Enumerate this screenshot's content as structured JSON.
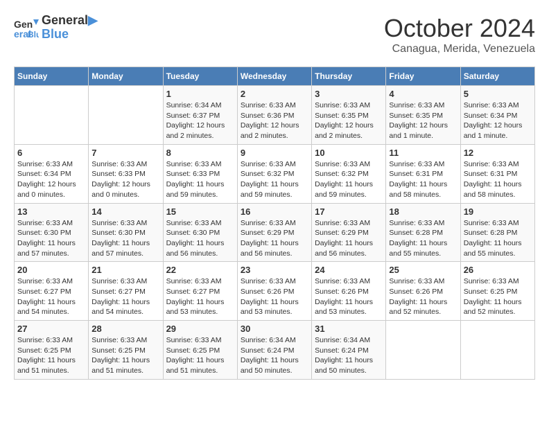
{
  "logo": {
    "line1": "General",
    "line2": "Blue"
  },
  "title": "October 2024",
  "subtitle": "Canagua, Merida, Venezuela",
  "headers": [
    "Sunday",
    "Monday",
    "Tuesday",
    "Wednesday",
    "Thursday",
    "Friday",
    "Saturday"
  ],
  "weeks": [
    [
      {
        "day": "",
        "info": ""
      },
      {
        "day": "",
        "info": ""
      },
      {
        "day": "1",
        "info": "Sunrise: 6:34 AM\nSunset: 6:37 PM\nDaylight: 12 hours\nand 2 minutes."
      },
      {
        "day": "2",
        "info": "Sunrise: 6:33 AM\nSunset: 6:36 PM\nDaylight: 12 hours\nand 2 minutes."
      },
      {
        "day": "3",
        "info": "Sunrise: 6:33 AM\nSunset: 6:35 PM\nDaylight: 12 hours\nand 2 minutes."
      },
      {
        "day": "4",
        "info": "Sunrise: 6:33 AM\nSunset: 6:35 PM\nDaylight: 12 hours\nand 1 minute."
      },
      {
        "day": "5",
        "info": "Sunrise: 6:33 AM\nSunset: 6:34 PM\nDaylight: 12 hours\nand 1 minute."
      }
    ],
    [
      {
        "day": "6",
        "info": "Sunrise: 6:33 AM\nSunset: 6:34 PM\nDaylight: 12 hours\nand 0 minutes."
      },
      {
        "day": "7",
        "info": "Sunrise: 6:33 AM\nSunset: 6:33 PM\nDaylight: 12 hours\nand 0 minutes."
      },
      {
        "day": "8",
        "info": "Sunrise: 6:33 AM\nSunset: 6:33 PM\nDaylight: 11 hours\nand 59 minutes."
      },
      {
        "day": "9",
        "info": "Sunrise: 6:33 AM\nSunset: 6:32 PM\nDaylight: 11 hours\nand 59 minutes."
      },
      {
        "day": "10",
        "info": "Sunrise: 6:33 AM\nSunset: 6:32 PM\nDaylight: 11 hours\nand 59 minutes."
      },
      {
        "day": "11",
        "info": "Sunrise: 6:33 AM\nSunset: 6:31 PM\nDaylight: 11 hours\nand 58 minutes."
      },
      {
        "day": "12",
        "info": "Sunrise: 6:33 AM\nSunset: 6:31 PM\nDaylight: 11 hours\nand 58 minutes."
      }
    ],
    [
      {
        "day": "13",
        "info": "Sunrise: 6:33 AM\nSunset: 6:30 PM\nDaylight: 11 hours\nand 57 minutes."
      },
      {
        "day": "14",
        "info": "Sunrise: 6:33 AM\nSunset: 6:30 PM\nDaylight: 11 hours\nand 57 minutes."
      },
      {
        "day": "15",
        "info": "Sunrise: 6:33 AM\nSunset: 6:30 PM\nDaylight: 11 hours\nand 56 minutes."
      },
      {
        "day": "16",
        "info": "Sunrise: 6:33 AM\nSunset: 6:29 PM\nDaylight: 11 hours\nand 56 minutes."
      },
      {
        "day": "17",
        "info": "Sunrise: 6:33 AM\nSunset: 6:29 PM\nDaylight: 11 hours\nand 56 minutes."
      },
      {
        "day": "18",
        "info": "Sunrise: 6:33 AM\nSunset: 6:28 PM\nDaylight: 11 hours\nand 55 minutes."
      },
      {
        "day": "19",
        "info": "Sunrise: 6:33 AM\nSunset: 6:28 PM\nDaylight: 11 hours\nand 55 minutes."
      }
    ],
    [
      {
        "day": "20",
        "info": "Sunrise: 6:33 AM\nSunset: 6:27 PM\nDaylight: 11 hours\nand 54 minutes."
      },
      {
        "day": "21",
        "info": "Sunrise: 6:33 AM\nSunset: 6:27 PM\nDaylight: 11 hours\nand 54 minutes."
      },
      {
        "day": "22",
        "info": "Sunrise: 6:33 AM\nSunset: 6:27 PM\nDaylight: 11 hours\nand 53 minutes."
      },
      {
        "day": "23",
        "info": "Sunrise: 6:33 AM\nSunset: 6:26 PM\nDaylight: 11 hours\nand 53 minutes."
      },
      {
        "day": "24",
        "info": "Sunrise: 6:33 AM\nSunset: 6:26 PM\nDaylight: 11 hours\nand 53 minutes."
      },
      {
        "day": "25",
        "info": "Sunrise: 6:33 AM\nSunset: 6:26 PM\nDaylight: 11 hours\nand 52 minutes."
      },
      {
        "day": "26",
        "info": "Sunrise: 6:33 AM\nSunset: 6:25 PM\nDaylight: 11 hours\nand 52 minutes."
      }
    ],
    [
      {
        "day": "27",
        "info": "Sunrise: 6:33 AM\nSunset: 6:25 PM\nDaylight: 11 hours\nand 51 minutes."
      },
      {
        "day": "28",
        "info": "Sunrise: 6:33 AM\nSunset: 6:25 PM\nDaylight: 11 hours\nand 51 minutes."
      },
      {
        "day": "29",
        "info": "Sunrise: 6:33 AM\nSunset: 6:25 PM\nDaylight: 11 hours\nand 51 minutes."
      },
      {
        "day": "30",
        "info": "Sunrise: 6:34 AM\nSunset: 6:24 PM\nDaylight: 11 hours\nand 50 minutes."
      },
      {
        "day": "31",
        "info": "Sunrise: 6:34 AM\nSunset: 6:24 PM\nDaylight: 11 hours\nand 50 minutes."
      },
      {
        "day": "",
        "info": ""
      },
      {
        "day": "",
        "info": ""
      }
    ]
  ]
}
